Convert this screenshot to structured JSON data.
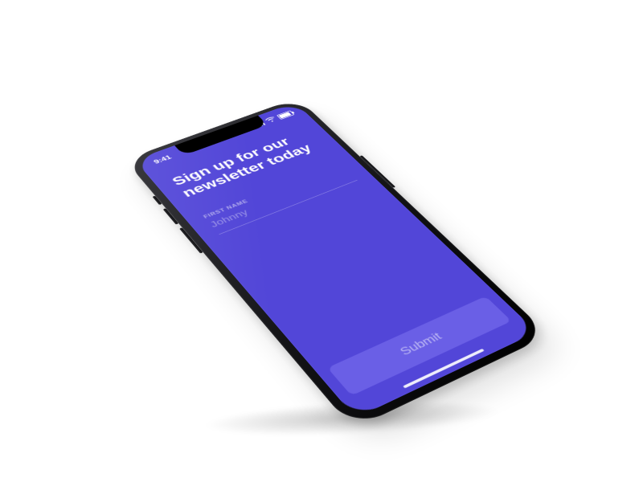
{
  "status": {
    "time": "9:41"
  },
  "heading": {
    "line1": "Sign up for our",
    "line2": "newsletter today"
  },
  "form": {
    "first_name_label": "FIRST NAME",
    "first_name_placeholder": "Johnny",
    "submit_label": "Submit"
  },
  "colors": {
    "primary": "#5246D8",
    "button": "#6A5FE6"
  }
}
